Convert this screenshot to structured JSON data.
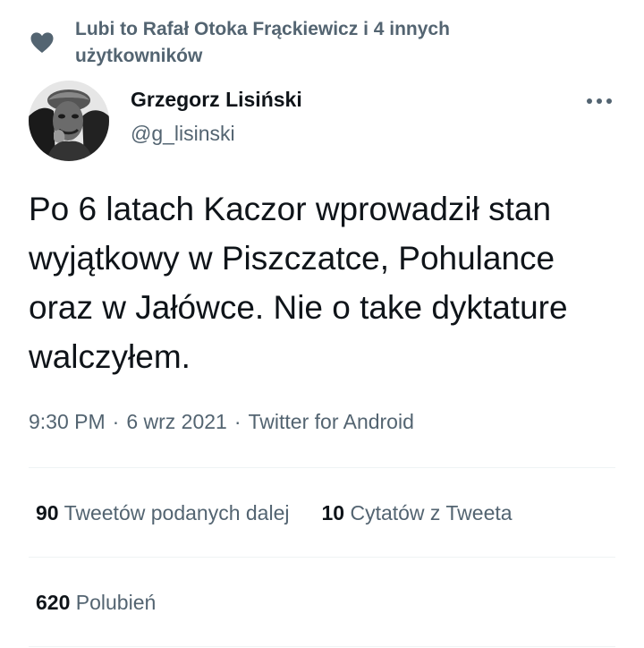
{
  "social_context": {
    "text": "Lubi to Rafał Otoka Frąckiewicz i 4 innych użytkowników",
    "icon": "heart-icon"
  },
  "author": {
    "name": "Grzegorz Lisiński",
    "handle": "@g_lisinski"
  },
  "tweet": {
    "text": "Po 6 latach Kaczor wprowadził stan wyjątkowy w Piszczatce, Pohulance oraz w Jałówce. Nie o take dyktature walczyłem."
  },
  "meta": {
    "time": "9:30 PM",
    "separator": "·",
    "date": "6 wrz 2021",
    "source": "Twitter for Android"
  },
  "stats": {
    "retweets_count": "90",
    "retweets_label": "Tweetów podanych dalej",
    "quotes_count": "10",
    "quotes_label": "Cytatów z Tweeta",
    "likes_count": "620",
    "likes_label": "Polubień"
  },
  "colors": {
    "primary_text": "#0f1419",
    "secondary_text": "#536471",
    "divider": "#eff3f4"
  }
}
